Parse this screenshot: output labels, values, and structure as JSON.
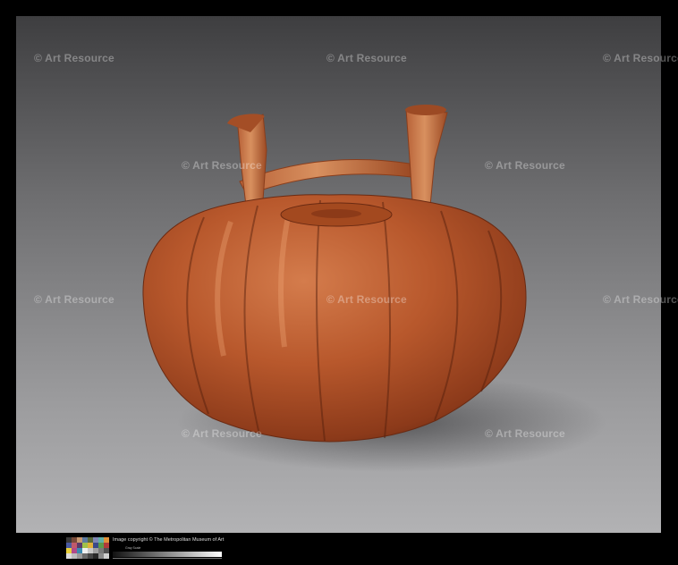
{
  "image": {
    "watermark_text": "© Art Resource",
    "subject": "pumpkin-shaped-stirrup-vessel"
  },
  "footer": {
    "copyright": "Image copyright © The Metropolitan Museum of Art",
    "scale_label": "Gray Scale"
  },
  "colors": {
    "background_top": "#3c3c3e",
    "background_bottom": "#a9a9ab",
    "vessel_body": "#b4532a",
    "vessel_highlight": "#e08d5c",
    "vessel_shadow": "#6e2c14",
    "handle": "#c06a3e",
    "frame": "#000000"
  },
  "swatch_colors": [
    "#3a3a3a",
    "#7a4b3a",
    "#c8986f",
    "#5c7aa0",
    "#5a6a3a",
    "#7f86b5",
    "#5fb0a8",
    "#e0913a",
    "#4a5aa0",
    "#c05a6a",
    "#5a3a6a",
    "#a0c04a",
    "#e0b03a",
    "#3a4a8a",
    "#5a9a4a",
    "#b03a3a",
    "#e8d03a",
    "#b04a8a",
    "#3a8ab0",
    "#f0f0f0",
    "#c8c8c8",
    "#a0a0a0",
    "#787878",
    "#505050",
    "#dcdcdc",
    "#bcbcbc",
    "#9a9a9a",
    "#6a6a6a",
    "#464646",
    "#282828",
    "#8a8a8a",
    "#cfcfcf"
  ]
}
